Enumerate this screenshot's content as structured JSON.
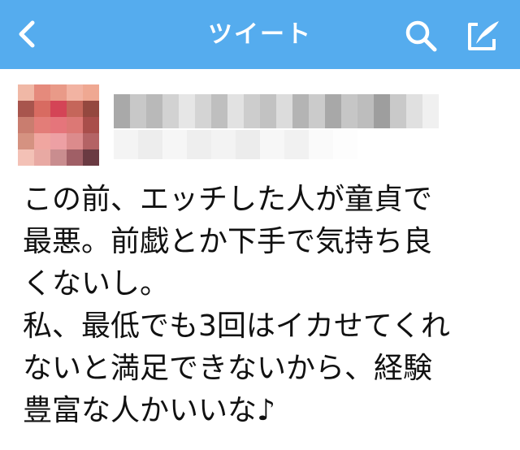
{
  "nav": {
    "title": "ツイート",
    "background_color": "#55acee",
    "icons": [
      "back-icon",
      "search-icon",
      "compose-icon"
    ]
  },
  "tweet": {
    "lines": [
      "この前、エッチした人が童貞で",
      "最悪。前戯とか下手で気持ち良",
      "くないし。",
      "私、最低でも3回はイカせてくれ",
      "ないと満足できないから、経験",
      "豊富な人かいいな♪"
    ]
  }
}
